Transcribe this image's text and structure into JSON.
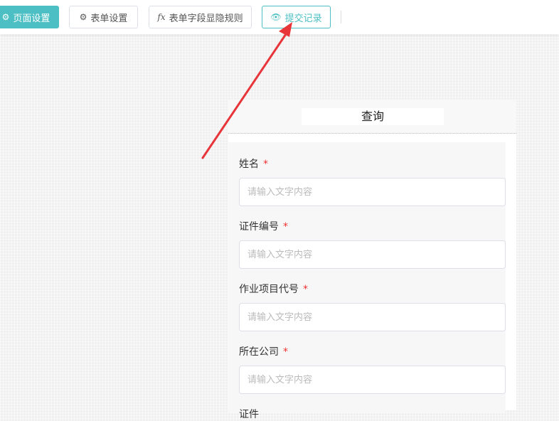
{
  "toolbar": {
    "buttons": [
      {
        "label": "页面设置",
        "icon": "gear-icon"
      },
      {
        "label": "表单设置",
        "icon": "gear-icon"
      },
      {
        "label": "表单字段显隐规则",
        "icon": "fx-icon"
      },
      {
        "label": "提交记录",
        "icon": "eye-icon"
      }
    ]
  },
  "form": {
    "title": "查询",
    "fields": [
      {
        "label": "姓名",
        "required": "*",
        "placeholder": "请输入文字内容"
      },
      {
        "label": "证件编号",
        "required": "*",
        "placeholder": "请输入文字内容"
      },
      {
        "label": "作业项目代号",
        "required": "*",
        "placeholder": "请输入文字内容"
      },
      {
        "label": "所在公司",
        "required": "*",
        "placeholder": "请输入文字内容"
      },
      {
        "label": "证件"
      }
    ]
  },
  "colors": {
    "accent": "#4bbfc3",
    "arrow": "#e8353a",
    "required": "#ee3333"
  }
}
